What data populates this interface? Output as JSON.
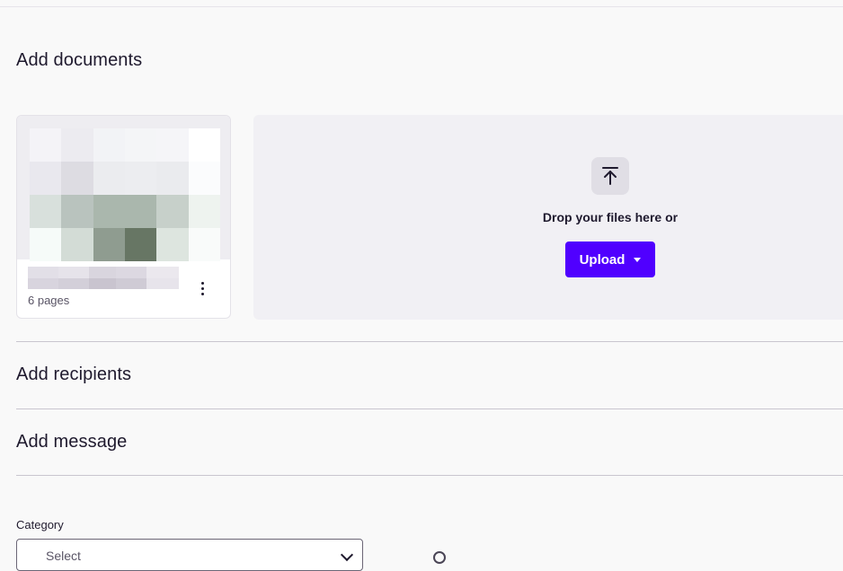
{
  "sections": {
    "documents": {
      "title": "Add documents"
    },
    "recipients": {
      "title": "Add recipients"
    },
    "message": {
      "title": "Add message"
    }
  },
  "document_card": {
    "pages": "6 pages",
    "thumbnail_icon": "blurred-thumbnail",
    "menu_icon": "kebab-menu-icon"
  },
  "dropzone": {
    "icon": "upload-arrow-icon",
    "text": "Drop your files here or",
    "button_label": "Upload"
  },
  "category": {
    "label": "Category",
    "value": "Select"
  },
  "colors": {
    "accent": "#5000ff",
    "background": "#f9f9f9",
    "dropzone": "#f1f0f4"
  }
}
